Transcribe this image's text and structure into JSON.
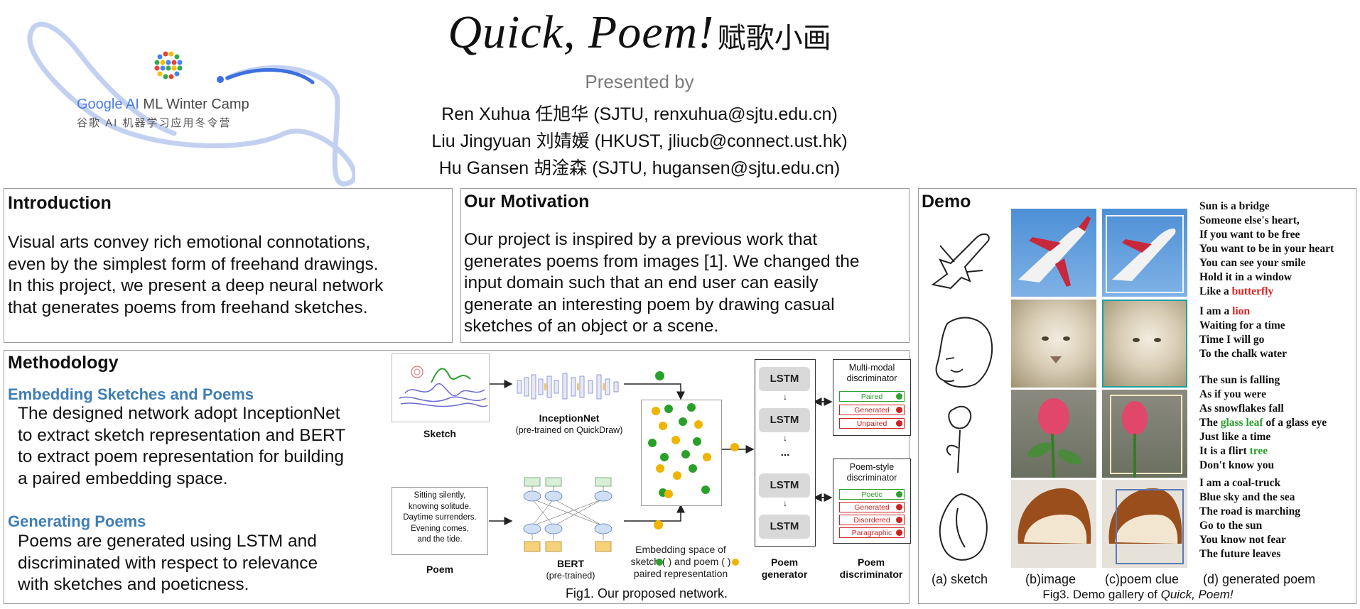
{
  "header": {
    "title_script": "Quick, Poem!",
    "title_cn": "赋歌小画",
    "presented_by": "Presented by",
    "authors": [
      "Ren Xuhua 任旭华 (SJTU, renxuhua@sjtu.edu.cn)",
      "Liu Jingyuan 刘婧媛 (HKUST, jliucb@connect.ust.hk)",
      "Hu Gansen 胡淦森 (SJTU, hugansen@sjtu.edu.cn)"
    ],
    "logo_line1_google": "Google AI",
    "logo_line1_rest": "ML Winter Camp",
    "logo_line2": "谷歌 AI 机器学习应用冬令营"
  },
  "introduction": {
    "heading": "Introduction",
    "lines": [
      "Visual arts convey rich emotional connotations,",
      "even by the simplest form of freehand drawings.",
      "In this project, we present a deep neural network",
      "that generates poems from freehand sketches."
    ]
  },
  "motivation": {
    "heading": "Our Motivation",
    "lines": [
      "Our project is inspired by a previous work that",
      "generates poems from images [1]. We changed the",
      "input domain such that an end user can easily",
      "generate an interesting poem by drawing casual",
      "sketches of an object or a scene."
    ]
  },
  "methodology": {
    "heading": "Methodology",
    "sub1": "Embedding Sketches and Poems",
    "sub1_lines": [
      "The designed network adopt InceptionNet",
      "to extract sketch representation and BERT",
      "to extract poem representation for building",
      "a paired embedding space."
    ],
    "sub2": "Generating Poems",
    "sub2_lines": [
      "Poems are generated using LSTM and",
      "discriminated with respect to relevance",
      "with sketches and poeticness."
    ]
  },
  "figure1": {
    "sketch_label": "Sketch",
    "inception_label": "InceptionNet",
    "inception_sub": "(pre-trained on QuickDraw)",
    "poem_box_lines": [
      "Sitting silently,",
      "knowing solitude.",
      "Daytime surrenders.",
      "Evening comes,",
      "and the tide."
    ],
    "poem_label": "Poem",
    "bert_label": "BERT",
    "bert_sub": "(pre-trained)",
    "embedding_caption_lines": [
      "Embedding space of",
      "sketch (   ) and poem (   )",
      "paired representation"
    ],
    "lstm_label": "LSTM",
    "lstm_ellipsis": "...",
    "generator_label_lines": [
      "Poem",
      "generator"
    ],
    "disc1_title_lines": [
      "Multi-modal",
      "discriminator"
    ],
    "disc1_items": [
      "Paired",
      "Generated",
      "Unpaired"
    ],
    "disc2_title_lines": [
      "Poem-style",
      "discriminator"
    ],
    "disc2_items": [
      "Poetic",
      "Generated",
      "Disordered",
      "Paragraphic"
    ],
    "discriminator_label_lines": [
      "Poem",
      "discriminator"
    ],
    "caption": "Fig1. Our proposed network.",
    "colors": {
      "green_dot": "#2aa02a",
      "yellow_dot": "#f0b400",
      "item_green": "#2ea02e",
      "item_red": "#d02020"
    }
  },
  "demo": {
    "heading": "Demo",
    "poems": [
      {
        "lines": [
          {
            "parts": [
              {
                "t": "Sun is a bridge"
              }
            ]
          },
          {
            "parts": [
              {
                "t": "Someone else's heart,"
              }
            ]
          },
          {
            "parts": [
              {
                "t": "If you want to be free"
              }
            ]
          },
          {
            "parts": [
              {
                "t": "You want to be in your heart"
              }
            ]
          },
          {
            "parts": [
              {
                "t": "You can see your smile"
              }
            ]
          },
          {
            "parts": [
              {
                "t": "Hold it in a window"
              }
            ]
          },
          {
            "parts": [
              {
                "t": "Like a "
              },
              {
                "t": "butterfly",
                "c": "red"
              }
            ]
          }
        ]
      },
      {
        "lines": [
          {
            "parts": [
              {
                "t": "I am a "
              },
              {
                "t": "lion",
                "c": "red"
              }
            ]
          },
          {
            "parts": [
              {
                "t": "Waiting for a time"
              }
            ]
          },
          {
            "parts": [
              {
                "t": "Time I will go"
              }
            ]
          },
          {
            "parts": [
              {
                "t": "To the chalk water"
              }
            ]
          }
        ]
      },
      {
        "lines": [
          {
            "parts": [
              {
                "t": "The sun is falling"
              }
            ]
          },
          {
            "parts": [
              {
                "t": "As if you were"
              }
            ]
          },
          {
            "parts": [
              {
                "t": "As snowflakes fall"
              }
            ]
          },
          {
            "parts": [
              {
                "t": "The "
              },
              {
                "t": "glass leaf",
                "c": "green"
              },
              {
                "t": " of a glass eye"
              }
            ]
          },
          {
            "parts": [
              {
                "t": "Just like a time"
              }
            ]
          },
          {
            "parts": [
              {
                "t": "It is a flirt "
              },
              {
                "t": "tree",
                "c": "green"
              }
            ]
          },
          {
            "parts": [
              {
                "t": "Don't know you"
              }
            ]
          }
        ]
      },
      {
        "lines": [
          {
            "parts": [
              {
                "t": "I am a coal-truck"
              }
            ]
          },
          {
            "parts": [
              {
                "t": "Blue sky and the sea"
              }
            ]
          },
          {
            "parts": [
              {
                "t": "The road is marching"
              }
            ]
          },
          {
            "parts": [
              {
                "t": "Go to the sun"
              }
            ]
          },
          {
            "parts": [
              {
                "t": "You know not fear"
              }
            ]
          },
          {
            "parts": [
              {
                "t": "The future leaves"
              }
            ]
          }
        ]
      }
    ],
    "column_labels": [
      "(a) sketch",
      "(b)image",
      "(c)poem clue",
      "(d) generated poem"
    ],
    "caption_prefix": "Fig3. Demo gallery of ",
    "caption_italic": "Quick, Poem!",
    "colors": {
      "red": "#e02020",
      "green": "#2ea02e"
    }
  }
}
